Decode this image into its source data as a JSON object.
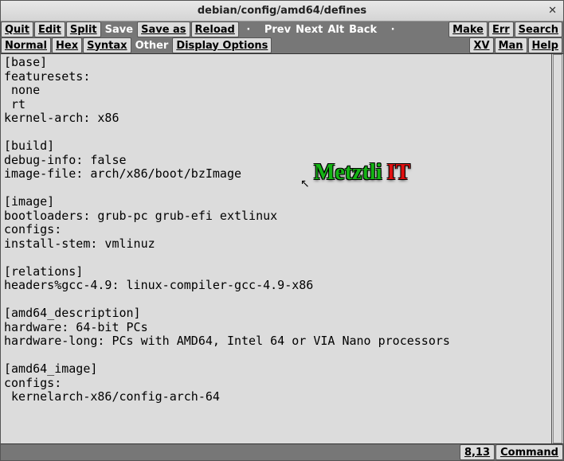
{
  "title": "debian/config/amd64/defines",
  "toolbar1": {
    "quit": "Quit",
    "edit": "Edit",
    "split": "Split",
    "save": "Save",
    "saveas": "Save as",
    "reload": "Reload",
    "prev": "Prev",
    "next": "Next",
    "alt": "Alt",
    "back": "Back",
    "make": "Make",
    "err": "Err",
    "search": "Search"
  },
  "toolbar2": {
    "normal": "Normal",
    "hex": "Hex",
    "syntax": "Syntax",
    "other": "Other",
    "dispopt": "Display Options",
    "xv": "XV",
    "man": "Man",
    "help": "Help"
  },
  "editor_text": "[base]\nfeaturesets:\n none\n rt\nkernel-arch: x86\n\n[build]\ndebug-info: false\nimage-file: arch/x86/boot/bzImage\n\n[image]\nbootloaders: grub-pc grub-efi extlinux\nconfigs:\ninstall-stem: vmlinuz\n\n[relations]\nheaders%gcc-4.9: linux-compiler-gcc-4.9-x86\n\n[amd64_description]\nhardware: 64-bit PCs\nhardware-long: PCs with AMD64, Intel 64 or VIA Nano processors\n\n[amd64_image]\nconfigs:\n kernelarch-x86/config-arch-64",
  "status": {
    "pos": "8,13",
    "mode": "Command"
  },
  "watermark": {
    "w1": "Metztli",
    "w2": "IT"
  }
}
